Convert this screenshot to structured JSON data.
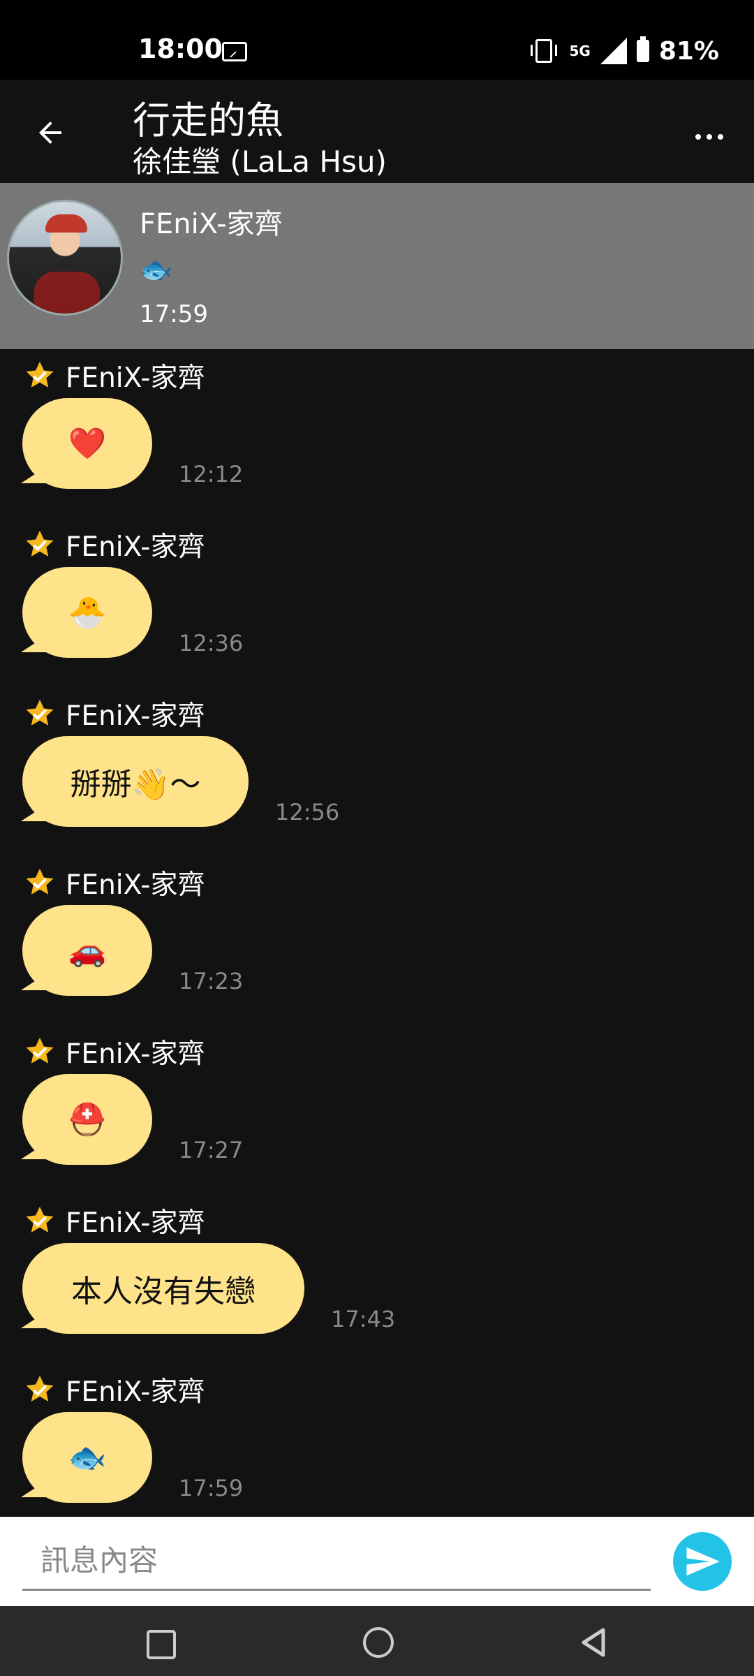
{
  "status_bar": {
    "time": "18:00",
    "network": "5G",
    "battery": "81%"
  },
  "header": {
    "title": "行走的魚",
    "subtitle": "徐佳瑩 (LaLa Hsu)"
  },
  "pinned": {
    "name": "FEniX-家齊",
    "message": "🐟",
    "time": "17:59"
  },
  "messages": [
    {
      "sender": "FEniX-家齊",
      "text": "❤️",
      "time": "12:12"
    },
    {
      "sender": "FEniX-家齊",
      "text": "🐣",
      "time": "12:36"
    },
    {
      "sender": "FEniX-家齊",
      "text": "掰掰👋～",
      "time": "12:56"
    },
    {
      "sender": "FEniX-家齊",
      "text": "🚗",
      "time": "17:23"
    },
    {
      "sender": "FEniX-家齊",
      "text": "⛑️",
      "time": "17:27"
    },
    {
      "sender": "FEniX-家齊",
      "text": "本人沒有失戀",
      "time": "17:43"
    },
    {
      "sender": "FEniX-家齊",
      "text": "🐟",
      "time": "17:59"
    }
  ],
  "input": {
    "placeholder": "訊息內容"
  },
  "icons": {
    "back": "arrow-left-icon",
    "more": "more-horizontal-icon",
    "star": "star-badge-icon",
    "send": "send-icon",
    "nav": [
      "recents-icon",
      "home-icon",
      "back-triangle-icon"
    ]
  },
  "colors": {
    "bubble": "#ffe38a",
    "send": "#23c3e8",
    "pinned_bg": "#777777",
    "star": "#f5b820"
  }
}
